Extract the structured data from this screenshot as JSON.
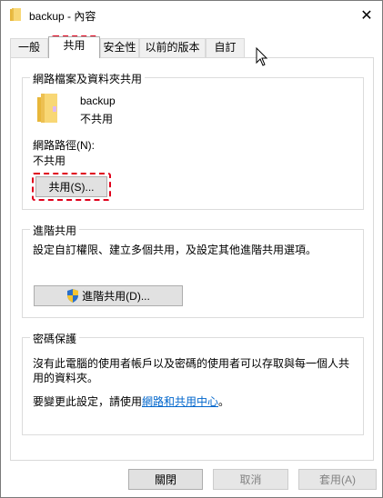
{
  "window": {
    "title": "backup - 內容",
    "close_glyph": "✕"
  },
  "tabs": [
    {
      "label": "一般"
    },
    {
      "label": "共用"
    },
    {
      "label": "安全性"
    },
    {
      "label": "以前的版本"
    },
    {
      "label": "自訂"
    }
  ],
  "share_section": {
    "heading": "網路檔案及資料夾共用",
    "folder_name": "backup",
    "folder_status": "不共用",
    "path_label": "網路路徑(N):",
    "path_value": "不共用",
    "share_button": "共用(S)..."
  },
  "advanced_section": {
    "heading": "進階共用",
    "description": "設定自訂權限、建立多個共用，及設定其他進階共用選項。",
    "button": "進階共用(D)..."
  },
  "password_section": {
    "heading": "密碼保護",
    "description_line1": "沒有此電腦的使用者帳戶以及密碼的使用者可以存取與每一個人共",
    "description_line2": "用的資料夾。",
    "change_prefix": "要變更此設定，請使用",
    "link_text": "網路和共用中心",
    "change_suffix": "。"
  },
  "footer": {
    "close": "關閉",
    "cancel": "取消",
    "apply": "套用(A)"
  },
  "colors": {
    "highlight_dash": "#e0001b",
    "link": "#0066cc",
    "folder": "#f3c94f"
  }
}
